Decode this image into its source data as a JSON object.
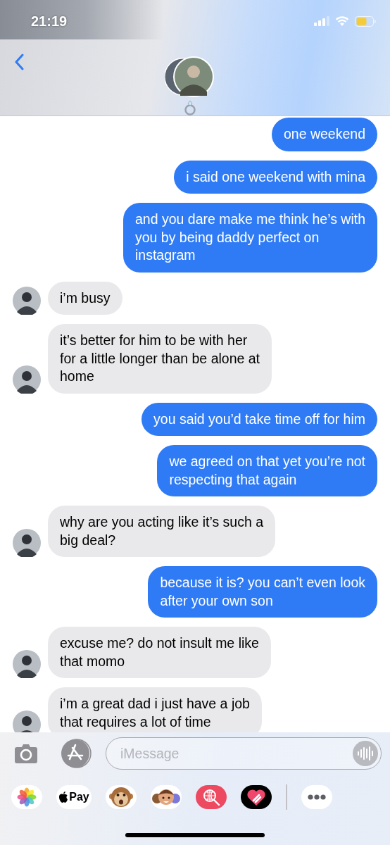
{
  "status_bar": {
    "time": "21:19"
  },
  "messages": [
    {
      "kind": "sent",
      "text": "one weekend"
    },
    {
      "kind": "sent",
      "text": "i said one weekend with mina"
    },
    {
      "kind": "sent",
      "text": "and you dare make me think he’s with\nyou by being daddy perfect on\ninstagram"
    },
    {
      "kind": "received",
      "text": "i’m busy"
    },
    {
      "kind": "received",
      "text": "it’s better for him to be with her\nfor a little longer than be alone at\nhome"
    },
    {
      "kind": "sent",
      "text": "you said you’d take time off for him"
    },
    {
      "kind": "sent",
      "text": "we agreed on that yet you’re not\nrespecting that again"
    },
    {
      "kind": "received",
      "text": "why are you acting like it’s such a\nbig deal?"
    },
    {
      "kind": "sent",
      "text": "because it is? you can’t even look\nafter your own son"
    },
    {
      "kind": "received",
      "text": "excuse me? do not insult me like\nthat momo"
    },
    {
      "kind": "received",
      "text": "i’m a great dad i just have a job\nthat requires a lot of time"
    }
  ],
  "composer": {
    "placeholder": "iMessage"
  },
  "app_drawer": {
    "apple_pay_label": "Pay"
  }
}
